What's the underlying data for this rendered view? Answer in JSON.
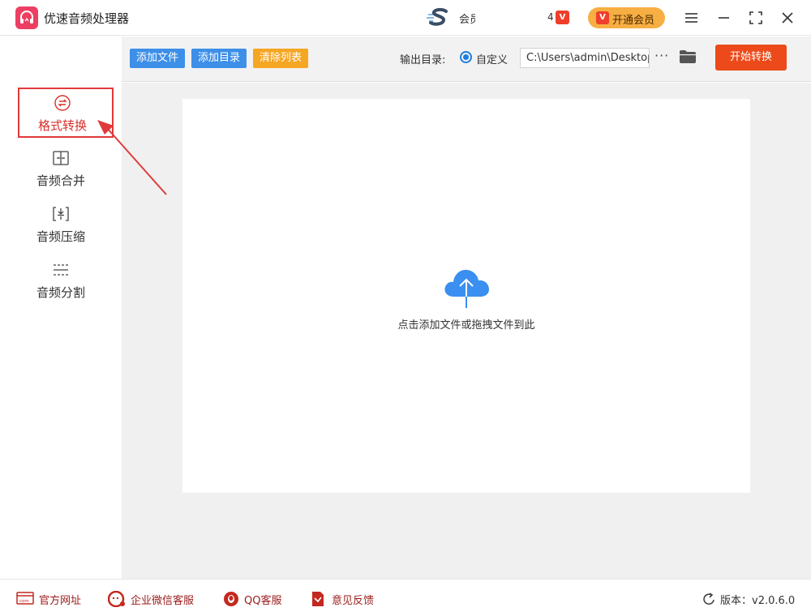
{
  "app": {
    "title": "优速音频处理器",
    "partner_text": "会员",
    "vip_count": "4",
    "vip_badge": "V",
    "open_vip_label": "开通会员"
  },
  "sidebar": {
    "items": [
      {
        "label": "格式转换",
        "icon": "convert-icon",
        "active": true
      },
      {
        "label": "音频合并",
        "icon": "merge-icon",
        "active": false
      },
      {
        "label": "音频压缩",
        "icon": "compress-icon",
        "active": false
      },
      {
        "label": "音频分割",
        "icon": "split-icon",
        "active": false
      }
    ]
  },
  "toolbar": {
    "add_file": "添加文件",
    "add_folder": "添加目录",
    "clear_list": "清除列表",
    "output_label": "输出目录:",
    "custom_label": "自定义",
    "output_path": "C:\\Users\\admin\\Desktop",
    "more": "···",
    "start": "开始转换"
  },
  "dropzone": {
    "hint": "点击添加文件或拖拽文件到此"
  },
  "footer": {
    "website": "官方网址",
    "wechat": "企业微信客服",
    "qq": "QQ客服",
    "feedback": "意见反馈",
    "version": "版本：v2.0.6.0"
  },
  "colors": {
    "accent_red": "#e03a3a",
    "start_orange": "#ec4a1a",
    "button_blue": "#3d8fe8",
    "clear_orange": "#f5a623",
    "cloud_blue": "#3a8ff0",
    "vip_gold": "#f7ae43"
  }
}
